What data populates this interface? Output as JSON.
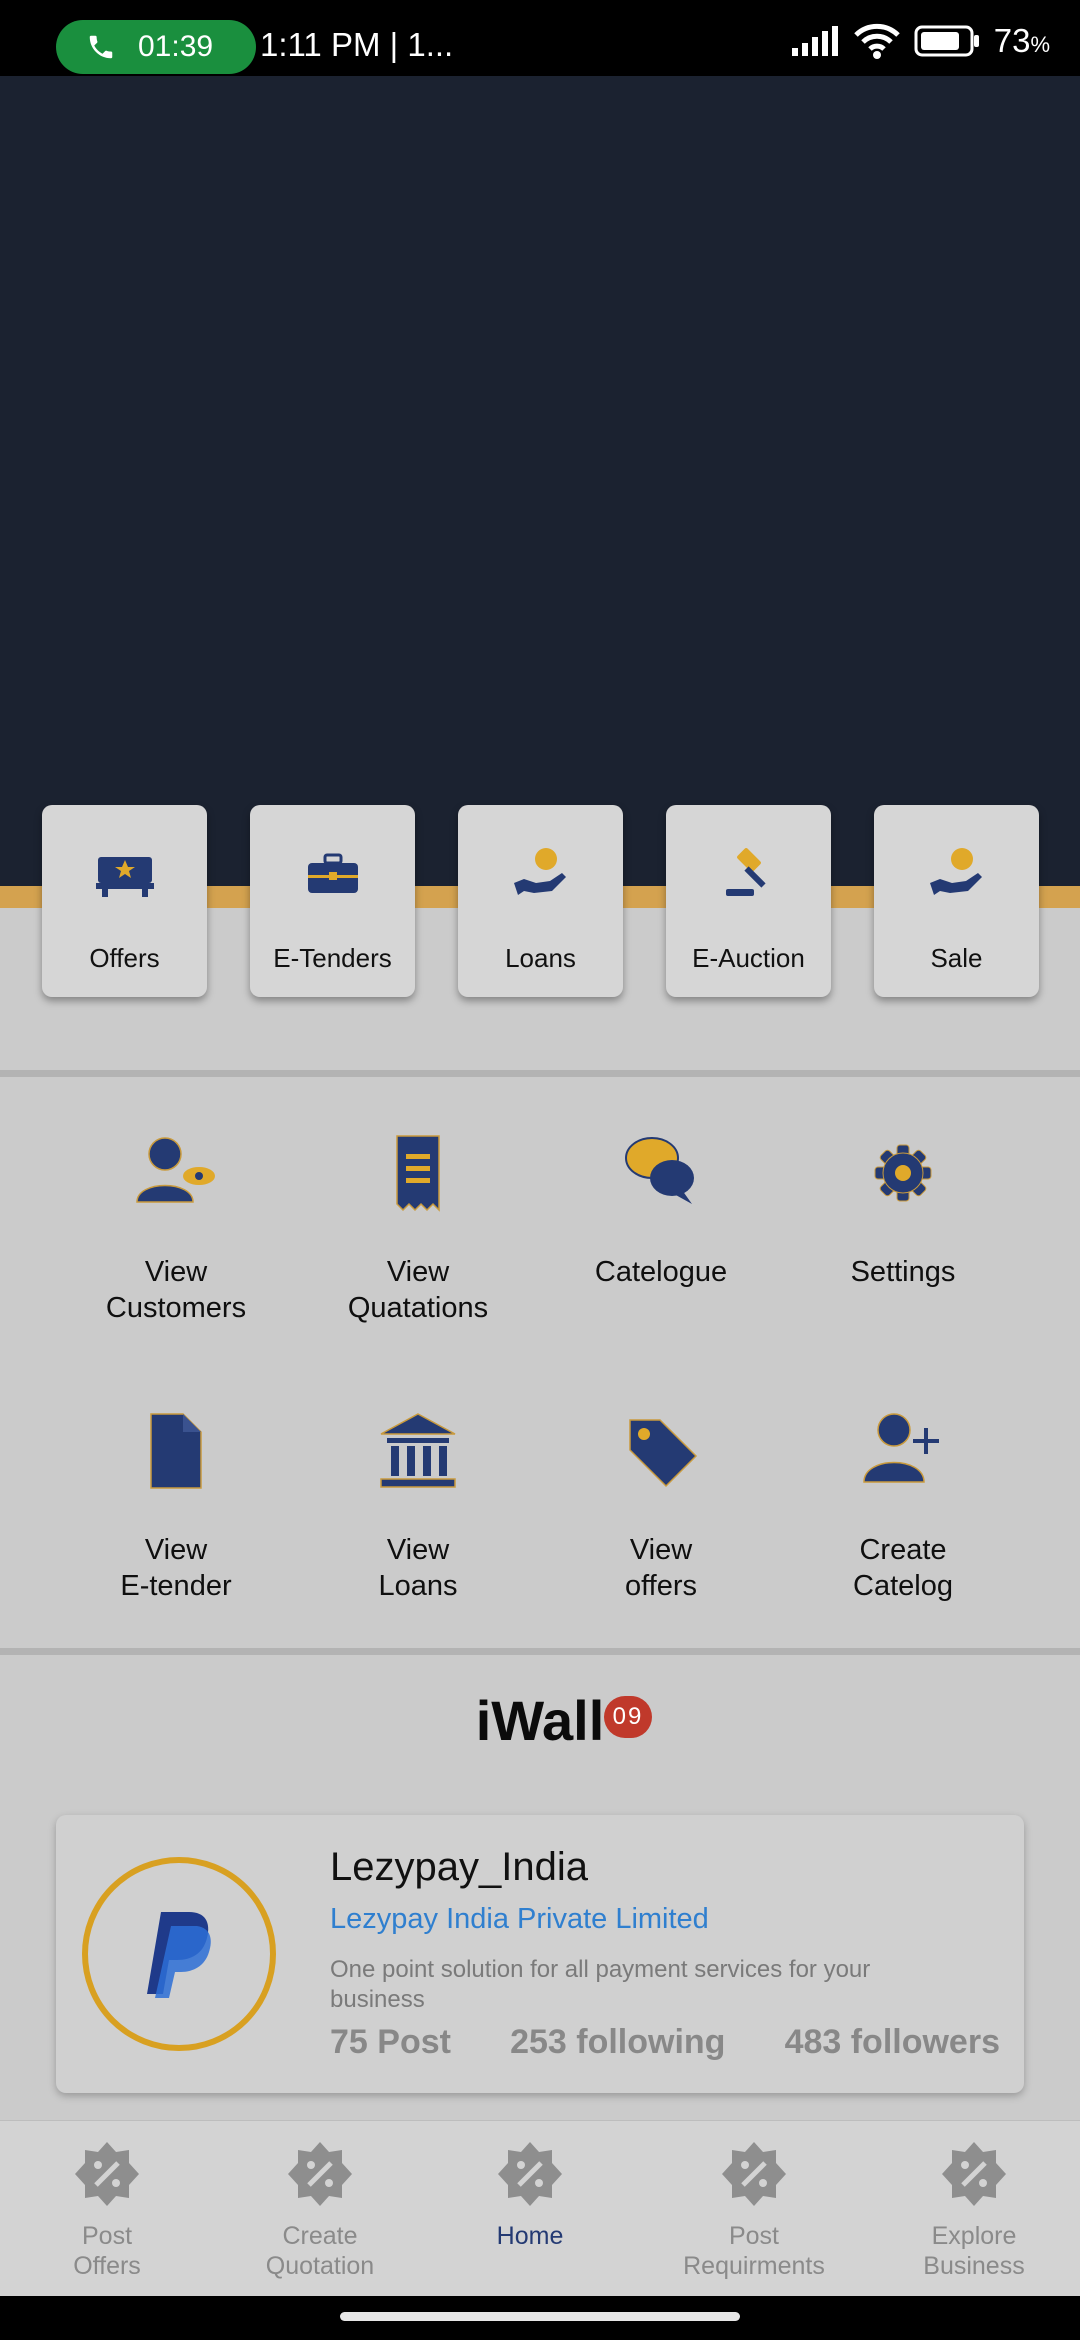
{
  "status_bar": {
    "call_timer": "01:39",
    "time": "1:11 PM | 1...",
    "battery": "73",
    "battery_unit": "%"
  },
  "quick_actions": [
    {
      "label": "Offers",
      "icon": "offers-tray-icon"
    },
    {
      "label": "E-Tenders",
      "icon": "briefcase-icon"
    },
    {
      "label": "Loans",
      "icon": "hand-coin-icon"
    },
    {
      "label": "E-Auction",
      "icon": "gavel-icon"
    },
    {
      "label": "Sale",
      "icon": "hand-coin-icon"
    }
  ],
  "grid": [
    {
      "label": "View\nCustomers",
      "icon": "customer-eye-icon"
    },
    {
      "label": "View\nQuatations",
      "icon": "receipt-icon"
    },
    {
      "label": "Catelogue",
      "icon": "chat-bubbles-icon"
    },
    {
      "label": "Settings",
      "icon": "gear-icon"
    },
    {
      "label": "View\nE-tender",
      "icon": "document-icon"
    },
    {
      "label": "View\nLoans",
      "icon": "bank-icon"
    },
    {
      "label": "View\noffers",
      "icon": "tag-icon"
    },
    {
      "label": "Create\nCatelog",
      "icon": "add-user-icon"
    }
  ],
  "iwall": {
    "title": "iWall",
    "badge": "09"
  },
  "profile": {
    "name": "Lezypay_India",
    "company": "Lezypay India Private Limited",
    "description": "One point solution for all payment services for your business",
    "posts": "75 Post",
    "following": "253 following",
    "followers": "483 followers",
    "logo": "paypal-logo"
  },
  "bottom_nav": [
    {
      "label": "Post\nOffers",
      "active": false
    },
    {
      "label": "Create\nQuotation",
      "active": false
    },
    {
      "label": "Home",
      "active": true
    },
    {
      "label": "Post\nRequirments",
      "active": false
    },
    {
      "label": "Explore\nBusiness",
      "active": false
    }
  ],
  "colors": {
    "hero": "#1b2230",
    "accent_gold": "#d4a24f",
    "icon_navy": "#243a73",
    "link_blue": "#2f7fcf",
    "badge_red": "#c0392b"
  }
}
